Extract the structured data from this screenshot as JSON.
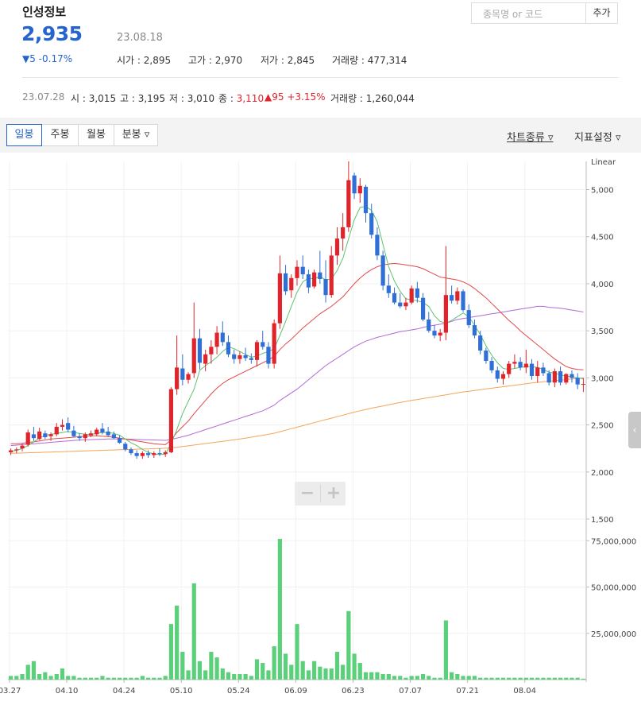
{
  "header": {
    "stock_name": "인성정보",
    "price": "2,935",
    "date": "23.08.18",
    "change": "▼5 -0.17%",
    "open_label": "시가 : ",
    "open": "2,895",
    "high_label": "고가 : ",
    "high": "2,970",
    "low_label": "저가 : ",
    "low": "2,845",
    "volume_label": "거래량 : ",
    "volume": "477,314"
  },
  "search": {
    "placeholder": "종목명 or 코드",
    "add_label": "추가"
  },
  "prev_day": {
    "date": "23.07.28",
    "open_label": "시 : ",
    "open": "3,015",
    "high_label": "고 : ",
    "high": "3,195",
    "low_label": "저 : ",
    "low": "3,010",
    "close_label": "종 : ",
    "close": "3,110",
    "change": "▲95 +3.15%",
    "volume_label": "거래량 : ",
    "volume": "1,260,044"
  },
  "toolbar": {
    "tabs": [
      "일봉",
      "주봉",
      "월봉",
      "분봉 ▿"
    ],
    "chart_type": "차트종류 ▿",
    "indicator": "지표설정 ▿"
  },
  "colors": {
    "up": "#e0242c",
    "down": "#2f6fd6",
    "ma5": "#5cc36f",
    "ma20": "#e34848",
    "ma60": "#b06ad6",
    "ma120": "#f3a55a",
    "volume": "#5bd07a"
  },
  "chart_data": {
    "type": "candlestick",
    "scale": "Linear",
    "price_ylim": [
      1500,
      5300
    ],
    "price_ticks": [
      "5,000",
      "4,500",
      "4,000",
      "3,500",
      "3,000",
      "2,500",
      "2,000",
      "1,500"
    ],
    "volume_ticks": [
      "75,000,000",
      "50,000,000",
      "25,000,000"
    ],
    "volume_ylim": [
      0,
      85000000
    ],
    "x_ticks": [
      "03.27",
      "04.10",
      "04.24",
      "05.10",
      "05.24",
      "06.09",
      "06.23",
      "07.07",
      "07.21",
      "08.04"
    ],
    "x_tick_index": [
      0,
      10,
      20,
      30,
      40,
      50,
      60,
      70,
      80,
      90
    ],
    "candles": [
      [
        2210,
        2250,
        2180,
        2230,
        2
      ],
      [
        2230,
        2260,
        2200,
        2240,
        2
      ],
      [
        2250,
        2300,
        2220,
        2280,
        3
      ],
      [
        2290,
        2450,
        2270,
        2420,
        8
      ],
      [
        2400,
        2480,
        2330,
        2360,
        10
      ],
      [
        2350,
        2470,
        2340,
        2430,
        3
      ],
      [
        2410,
        2440,
        2350,
        2370,
        4
      ],
      [
        2380,
        2420,
        2330,
        2400,
        2
      ],
      [
        2400,
        2520,
        2380,
        2480,
        3
      ],
      [
        2480,
        2560,
        2440,
        2500,
        6
      ],
      [
        2520,
        2580,
        2420,
        2450,
        2
      ],
      [
        2440,
        2490,
        2370,
        2380,
        2
      ],
      [
        2380,
        2410,
        2330,
        2360,
        1
      ],
      [
        2360,
        2420,
        2320,
        2400,
        1
      ],
      [
        2390,
        2440,
        2370,
        2410,
        1
      ],
      [
        2400,
        2470,
        2380,
        2450,
        1
      ],
      [
        2460,
        2520,
        2400,
        2420,
        2
      ],
      [
        2430,
        2480,
        2380,
        2390,
        1
      ],
      [
        2400,
        2430,
        2350,
        2360,
        1
      ],
      [
        2360,
        2390,
        2300,
        2310,
        1
      ],
      [
        2300,
        2320,
        2220,
        2240,
        1
      ],
      [
        2240,
        2260,
        2180,
        2200,
        1
      ],
      [
        2200,
        2230,
        2140,
        2170,
        1
      ],
      [
        2170,
        2220,
        2140,
        2200,
        2
      ],
      [
        2200,
        2230,
        2150,
        2180,
        1
      ],
      [
        2180,
        2220,
        2150,
        2200,
        1
      ],
      [
        2200,
        2250,
        2170,
        2190,
        1
      ],
      [
        2190,
        2230,
        2160,
        2210,
        2
      ],
      [
        2210,
        2900,
        2200,
        2880,
        30
      ],
      [
        2880,
        3450,
        2820,
        3110,
        40
      ],
      [
        3100,
        3250,
        2920,
        2980,
        15
      ],
      [
        2980,
        3060,
        2940,
        3040,
        5
      ],
      [
        3050,
        3800,
        3000,
        3420,
        52
      ],
      [
        3420,
        3520,
        3090,
        3160,
        10
      ],
      [
        3150,
        3300,
        3070,
        3250,
        5
      ],
      [
        3250,
        3400,
        3150,
        3330,
        15
      ],
      [
        3330,
        3550,
        3250,
        3480,
        12
      ],
      [
        3480,
        3600,
        3340,
        3380,
        6
      ],
      [
        3380,
        3450,
        3220,
        3250,
        4
      ],
      [
        3250,
        3300,
        3150,
        3200,
        3
      ],
      [
        3200,
        3280,
        3150,
        3240,
        3
      ],
      [
        3240,
        3320,
        3180,
        3210,
        3
      ],
      [
        3210,
        3260,
        3150,
        3190,
        2
      ],
      [
        3190,
        3400,
        3120,
        3380,
        11
      ],
      [
        3380,
        3500,
        3300,
        3330,
        9
      ],
      [
        3330,
        3380,
        3100,
        3150,
        5
      ],
      [
        3150,
        3620,
        3100,
        3580,
        18
      ],
      [
        3580,
        4300,
        3520,
        4110,
        76
      ],
      [
        4110,
        4200,
        3880,
        3920,
        14
      ],
      [
        3930,
        4100,
        3850,
        4060,
        8
      ],
      [
        4060,
        4250,
        3980,
        4180,
        30
      ],
      [
        4180,
        4300,
        4050,
        4100,
        10
      ],
      [
        4100,
        4150,
        3900,
        3960,
        5
      ],
      [
        3970,
        4150,
        3950,
        4120,
        10
      ],
      [
        4120,
        4350,
        4000,
        4050,
        7
      ],
      [
        4050,
        4250,
        3800,
        3880,
        6
      ],
      [
        3880,
        4400,
        3850,
        4300,
        6
      ],
      [
        4300,
        4600,
        4200,
        4480,
        15
      ],
      [
        4480,
        4750,
        4350,
        4600,
        8
      ],
      [
        4600,
        5300,
        4550,
        5100,
        37
      ],
      [
        5150,
        5180,
        4900,
        4960,
        14
      ],
      [
        4960,
        5120,
        4860,
        5040,
        9
      ],
      [
        5030,
        5050,
        4650,
        4750,
        4
      ],
      [
        4750,
        4850,
        4480,
        4520,
        4
      ],
      [
        4520,
        4600,
        4250,
        4300,
        4
      ],
      [
        4300,
        4350,
        3930,
        3980,
        3
      ],
      [
        3980,
        4100,
        3850,
        3900,
        3
      ],
      [
        3900,
        3960,
        3780,
        3800,
        2
      ],
      [
        3800,
        3900,
        3740,
        3760,
        2
      ],
      [
        3760,
        3850,
        3720,
        3800,
        1
      ],
      [
        3800,
        3980,
        3780,
        3950,
        2
      ],
      [
        3950,
        4020,
        3800,
        3850,
        2
      ],
      [
        3850,
        3900,
        3600,
        3620,
        3
      ],
      [
        3620,
        3700,
        3480,
        3500,
        2
      ],
      [
        3500,
        3560,
        3420,
        3450,
        1
      ],
      [
        3450,
        3520,
        3390,
        3480,
        1
      ],
      [
        3480,
        4400,
        3400,
        3880,
        32
      ],
      [
        3880,
        3980,
        3790,
        3820,
        4
      ],
      [
        3820,
        3960,
        3780,
        3920,
        3
      ],
      [
        3920,
        3940,
        3700,
        3720,
        2
      ],
      [
        3720,
        3780,
        3530,
        3560,
        2
      ],
      [
        3560,
        3620,
        3420,
        3450,
        2
      ],
      [
        3450,
        3500,
        3250,
        3290,
        1
      ],
      [
        3290,
        3320,
        3150,
        3180,
        1
      ],
      [
        3180,
        3220,
        3050,
        3080,
        1
      ],
      [
        3080,
        3120,
        2950,
        2990,
        1
      ],
      [
        2990,
        3070,
        2930,
        3040,
        1
      ],
      [
        3040,
        3180,
        3000,
        3150,
        1
      ],
      [
        3150,
        3250,
        3100,
        3170,
        1
      ],
      [
        3170,
        3220,
        3080,
        3110,
        1
      ],
      [
        3110,
        3300,
        3050,
        3150,
        1
      ],
      [
        3150,
        3200,
        2980,
        3020,
        1
      ],
      [
        3020,
        3180,
        2950,
        3110,
        1
      ],
      [
        3110,
        3160,
        3020,
        3050,
        1
      ],
      [
        3050,
        3080,
        2920,
        2950,
        1
      ],
      [
        2950,
        3100,
        2900,
        3070,
        1
      ],
      [
        3070,
        3120,
        2920,
        2950,
        1
      ],
      [
        2950,
        3050,
        2930,
        3040,
        1
      ],
      [
        3040,
        3080,
        2950,
        3000,
        1
      ],
      [
        3000,
        3050,
        2880,
        2930,
        1
      ],
      [
        2930,
        3000,
        2850,
        2935,
        0.5
      ]
    ],
    "ma20": [
      2300,
      2300,
      2305,
      2315,
      2320,
      2330,
      2340,
      2350,
      2355,
      2360,
      2365,
      2370,
      2375,
      2380,
      2385,
      2385,
      2380,
      2375,
      2370,
      2360,
      2350,
      2340,
      2330,
      2320,
      2310,
      2300,
      2295,
      2290,
      2340,
      2420,
      2480,
      2540,
      2620,
      2690,
      2760,
      2830,
      2890,
      2940,
      2980,
      3010,
      3040,
      3070,
      3100,
      3130,
      3160,
      3190,
      3230,
      3300,
      3360,
      3410,
      3470,
      3530,
      3580,
      3630,
      3680,
      3720,
      3760,
      3810,
      3860,
      3930,
      4000,
      4060,
      4110,
      4150,
      4180,
      4200,
      4210,
      4215,
      4210,
      4200,
      4190,
      4180,
      4160,
      4130,
      4100,
      4070,
      4060,
      4050,
      4040,
      4020,
      3990,
      3950,
      3900,
      3850,
      3790,
      3730,
      3670,
      3610,
      3560,
      3500,
      3450,
      3400,
      3350,
      3300,
      3250,
      3200,
      3160,
      3120,
      3100,
      3090,
      3085
    ],
    "ma5": [
      2220,
      2230,
      2250,
      2280,
      2320,
      2360,
      2390,
      2400,
      2410,
      2420,
      2430,
      2420,
      2410,
      2400,
      2400,
      2410,
      2420,
      2420,
      2410,
      2390,
      2350,
      2310,
      2280,
      2240,
      2210,
      2190,
      2185,
      2190,
      2300,
      2450,
      2620,
      2750,
      2880,
      3080,
      3130,
      3170,
      3220,
      3280,
      3330,
      3310,
      3280,
      3250,
      3220,
      3230,
      3260,
      3280,
      3310,
      3450,
      3600,
      3760,
      3910,
      4020,
      4060,
      4050,
      4080,
      4040,
      4050,
      4140,
      4270,
      4480,
      4680,
      4810,
      4820,
      4780,
      4660,
      4420,
      4180,
      4030,
      3920,
      3840,
      3830,
      3820,
      3800,
      3760,
      3660,
      3600,
      3580,
      3610,
      3650,
      3690,
      3650,
      3560,
      3460,
      3340,
      3240,
      3160,
      3100,
      3090,
      3100,
      3110,
      3120,
      3120,
      3110,
      3090,
      3060,
      3050,
      3030,
      3020,
      3010,
      3000,
      2990
    ],
    "ma60": [
      2280,
      2285,
      2290,
      2295,
      2300,
      2305,
      2310,
      2315,
      2320,
      2325,
      2330,
      2335,
      2340,
      2342,
      2344,
      2346,
      2348,
      2350,
      2350,
      2350,
      2350,
      2348,
      2346,
      2344,
      2342,
      2340,
      2338,
      2336,
      2345,
      2360,
      2375,
      2390,
      2410,
      2430,
      2450,
      2470,
      2490,
      2510,
      2530,
      2550,
      2570,
      2590,
      2610,
      2630,
      2650,
      2680,
      2710,
      2760,
      2800,
      2840,
      2880,
      2930,
      2980,
      3030,
      3080,
      3130,
      3170,
      3210,
      3250,
      3290,
      3330,
      3360,
      3390,
      3410,
      3430,
      3445,
      3460,
      3475,
      3490,
      3500,
      3510,
      3520,
      3535,
      3550,
      3560,
      3570,
      3580,
      3600,
      3620,
      3630,
      3640,
      3650,
      3660,
      3670,
      3680,
      3690,
      3700,
      3710,
      3720,
      3730,
      3740,
      3750,
      3760,
      3760,
      3750,
      3745,
      3740,
      3730,
      3720,
      3710,
      3700
    ],
    "ma120": [
      2200,
      2200,
      2202,
      2204,
      2206,
      2208,
      2210,
      2212,
      2214,
      2216,
      2218,
      2220,
      2222,
      2224,
      2226,
      2228,
      2230,
      2232,
      2234,
      2236,
      2238,
      2240,
      2242,
      2244,
      2246,
      2248,
      2250,
      2252,
      2256,
      2262,
      2270,
      2278,
      2286,
      2294,
      2302,
      2310,
      2318,
      2326,
      2334,
      2342,
      2350,
      2360,
      2370,
      2380,
      2390,
      2400,
      2412,
      2428,
      2444,
      2460,
      2476,
      2492,
      2508,
      2524,
      2540,
      2556,
      2572,
      2588,
      2604,
      2620,
      2636,
      2650,
      2664,
      2678,
      2690,
      2702,
      2714,
      2726,
      2738,
      2750,
      2760,
      2770,
      2780,
      2790,
      2800,
      2810,
      2820,
      2830,
      2840,
      2850,
      2858,
      2866,
      2874,
      2882,
      2890,
      2898,
      2906,
      2914,
      2922,
      2930,
      2938,
      2946,
      2952,
      2958,
      2964,
      2970,
      2976,
      2982,
      2988,
      2994,
      3000
    ]
  },
  "ui": {
    "zoom_minus": "−",
    "zoom_plus": "+",
    "side_arrow": "‹"
  }
}
